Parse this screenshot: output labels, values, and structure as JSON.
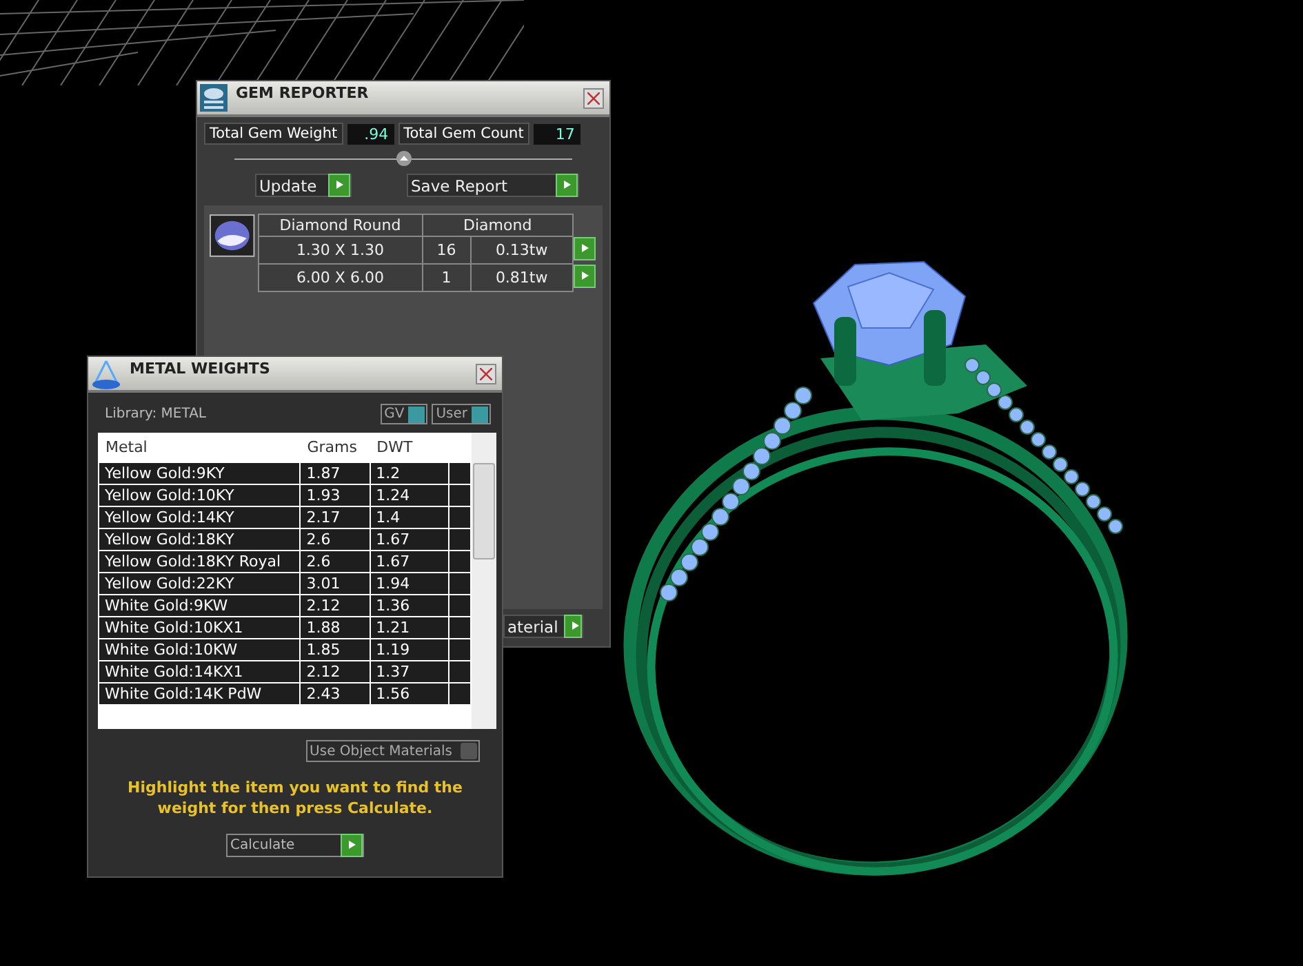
{
  "gem_reporter": {
    "title": "GEM REPORTER",
    "total_weight_label": "Total Gem Weight",
    "total_weight": ".94",
    "total_count_label": "Total Gem Count",
    "total_count": "17",
    "buttons": [
      {
        "label": "Update"
      },
      {
        "label": "Save Report"
      }
    ],
    "table": {
      "columns": [
        "Diamond Round",
        "Diamond"
      ],
      "rows": [
        {
          "size": "1.30 X 1.30",
          "count": "16",
          "weight": "0.13tw"
        },
        {
          "size": "6.00 X 6.00",
          "count": "1",
          "weight": "0.81tw"
        }
      ]
    },
    "partial_button": "aterial"
  },
  "metal_weights": {
    "title": "METAL WEIGHTS",
    "library": "Library: METAL",
    "toggles": [
      {
        "label": "GV",
        "on": true
      },
      {
        "label": "User",
        "on": true
      }
    ],
    "columns": [
      "Metal",
      "Grams",
      "DWT"
    ],
    "rows": [
      {
        "metal": "Yellow Gold:9KY",
        "grams": "1.87",
        "dwt": "1.2"
      },
      {
        "metal": "Yellow Gold:10KY",
        "grams": "1.93",
        "dwt": "1.24"
      },
      {
        "metal": "Yellow Gold:14KY",
        "grams": "2.17",
        "dwt": "1.4"
      },
      {
        "metal": "Yellow Gold:18KY",
        "grams": "2.6",
        "dwt": "1.67"
      },
      {
        "metal": "Yellow Gold:18KY Royal",
        "grams": "2.6",
        "dwt": "1.67"
      },
      {
        "metal": "Yellow Gold:22KY",
        "grams": "3.01",
        "dwt": "1.94"
      },
      {
        "metal": "White Gold:9KW",
        "grams": "2.12",
        "dwt": "1.36"
      },
      {
        "metal": "White Gold:10KX1",
        "grams": "1.88",
        "dwt": "1.21"
      },
      {
        "metal": "White Gold:10KW",
        "grams": "1.85",
        "dwt": "1.19"
      },
      {
        "metal": "White Gold:14KX1",
        "grams": "2.12",
        "dwt": "1.37"
      },
      {
        "metal": "White Gold:14K PdW",
        "grams": "2.43",
        "dwt": "1.56"
      }
    ],
    "use_object_materials": "Use Object Materials",
    "instructions": "Highlight the item you want to find the weight for then press Calculate.",
    "calculate_button": "Calculate"
  }
}
